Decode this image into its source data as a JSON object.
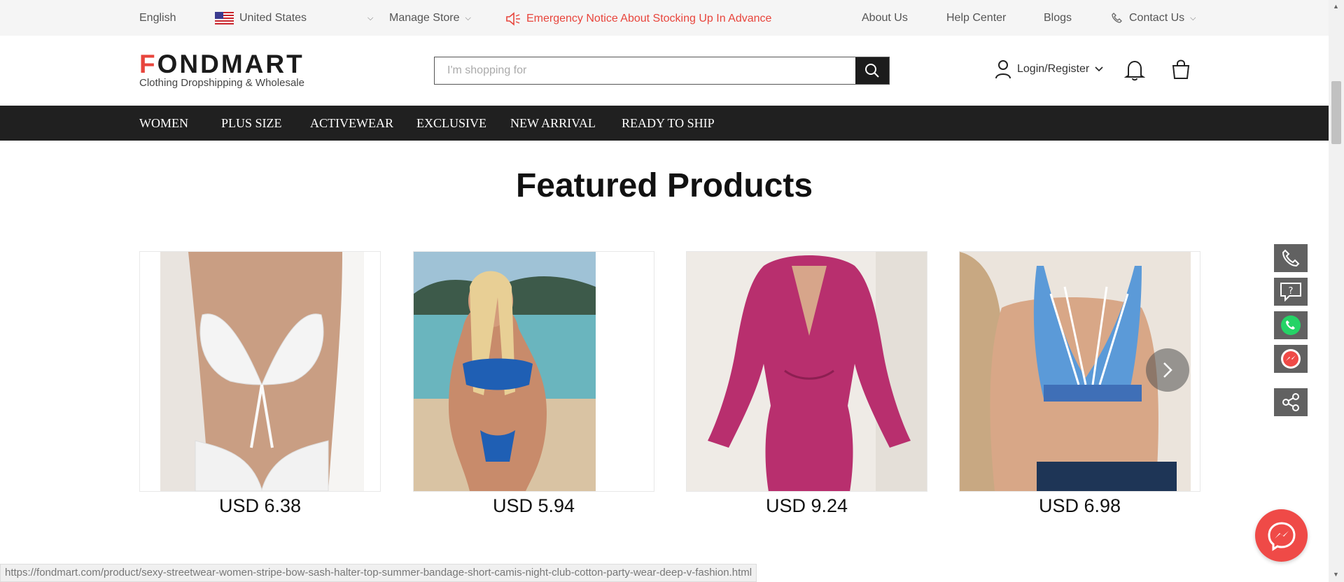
{
  "topbar": {
    "language": "English",
    "country": "United States",
    "manage_store": "Manage Store",
    "notice": "Emergency Notice About Stocking Up In Advance",
    "about": "About Us",
    "help": "Help Center",
    "blogs": "Blogs",
    "contact": "Contact Us"
  },
  "header": {
    "logo": "FONDMART",
    "tagline": "Clothing Dropshipping & Wholesale",
    "search_placeholder": "I'm shopping for",
    "login": "Login/Register"
  },
  "nav": {
    "items": [
      "WOMEN",
      "PLUS SIZE",
      "ACTIVEWEAR",
      "EXCLUSIVE",
      "NEW ARRIVAL",
      "READY TO SHIP"
    ]
  },
  "main": {
    "title": "Featured Products",
    "products": [
      {
        "price": "USD 6.38"
      },
      {
        "price": "USD 5.94"
      },
      {
        "price": "USD 9.24"
      },
      {
        "price": "USD 6.98"
      }
    ]
  },
  "statusbar": {
    "url": "https://fondmart.com/product/sexy-streetwear-women-stripe-bow-sash-halter-top-summer-bandage-short-camis-night-club-cotton-party-wear-deep-v-fashion.html"
  },
  "colors": {
    "accent": "#e8453c",
    "nav_bg": "#202020",
    "whatsapp": "#25d366",
    "messenger": "#ef4a47"
  }
}
